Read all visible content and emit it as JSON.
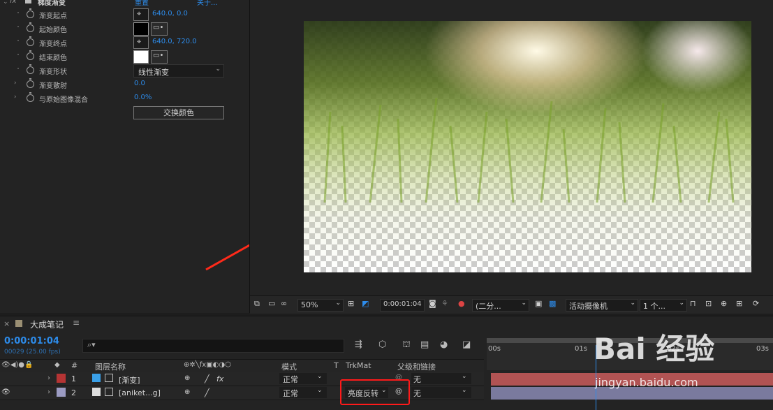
{
  "effect_panel": {
    "effect_name": "梯度渐变",
    "reset_label": "重置",
    "about_label": "关于...",
    "properties": [
      {
        "label": "渐变起点",
        "value": "640.0, 0.0",
        "type": "point"
      },
      {
        "label": "起始颜色",
        "color": "#000000",
        "type": "color"
      },
      {
        "label": "渐变终点",
        "value": "640.0, 720.0",
        "type": "point"
      },
      {
        "label": "结束颜色",
        "color": "#ffffff",
        "type": "color"
      },
      {
        "label": "渐变形状",
        "value": "线性渐变",
        "type": "dropdown"
      },
      {
        "label": "渐变散射",
        "value": "0.0",
        "type": "number"
      },
      {
        "label": "与原始图像混合",
        "value": "0.0%",
        "type": "number"
      }
    ],
    "swap_button": "交换颜色"
  },
  "viewer_toolbar": {
    "zoom": "50%",
    "timecode": "0:00:01:04",
    "resolution": "(二分...",
    "camera": "活动摄像机",
    "views": "1 个..."
  },
  "timeline": {
    "comp_name": "大成笔记",
    "current_time": "0:00:01:04",
    "frame_info": "00029 (25.00 fps)",
    "search_placeholder": "",
    "columns": {
      "num": "#",
      "layer_name": "图层名称",
      "mode": "模式",
      "t": "T",
      "trkmat": "TrkMat",
      "parent": "父级和链接"
    },
    "layers": [
      {
        "num": "1",
        "name": "[渐变]",
        "mode": "正常",
        "trkmat": "",
        "parent": "无",
        "label_color": "#b53434"
      },
      {
        "num": "2",
        "name": "[aniket...g]",
        "mode": "正常",
        "trkmat": "亮度反转",
        "parent": "无",
        "label_color": "#9b9bc2"
      }
    ],
    "ruler_labels": [
      "00s",
      "01s",
      "02s",
      "03s"
    ]
  },
  "watermark": {
    "brand": "Bai 经验",
    "url": "jingyan.baidu.com"
  }
}
